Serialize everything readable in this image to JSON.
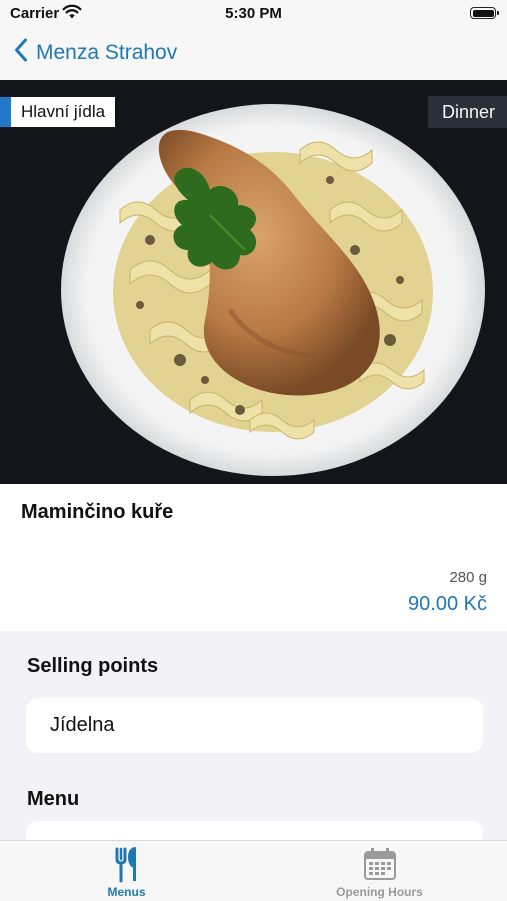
{
  "status_bar": {
    "carrier": "Carrier",
    "time": "5:30 PM"
  },
  "nav": {
    "back_label": "Menza Strahov"
  },
  "photo": {
    "category_tag": "Hlavní jídla",
    "meal_tag": "Dinner"
  },
  "dish": {
    "name": "Maminčino kuře",
    "weight": "280 g",
    "price": "90.00 Kč"
  },
  "selling_points": {
    "title": "Selling points",
    "items": [
      "Jídelna"
    ]
  },
  "menu_section": {
    "title": "Menu"
  },
  "tabs": [
    {
      "label": "Menus",
      "icon": "fork-knife-icon",
      "active": true
    },
    {
      "label": "Opening Hours",
      "icon": "calendar-icon",
      "active": false
    }
  ],
  "colors": {
    "accent": "#1f78b4",
    "tag_accent": "#1f78c9",
    "photo_bg": "#121317"
  }
}
